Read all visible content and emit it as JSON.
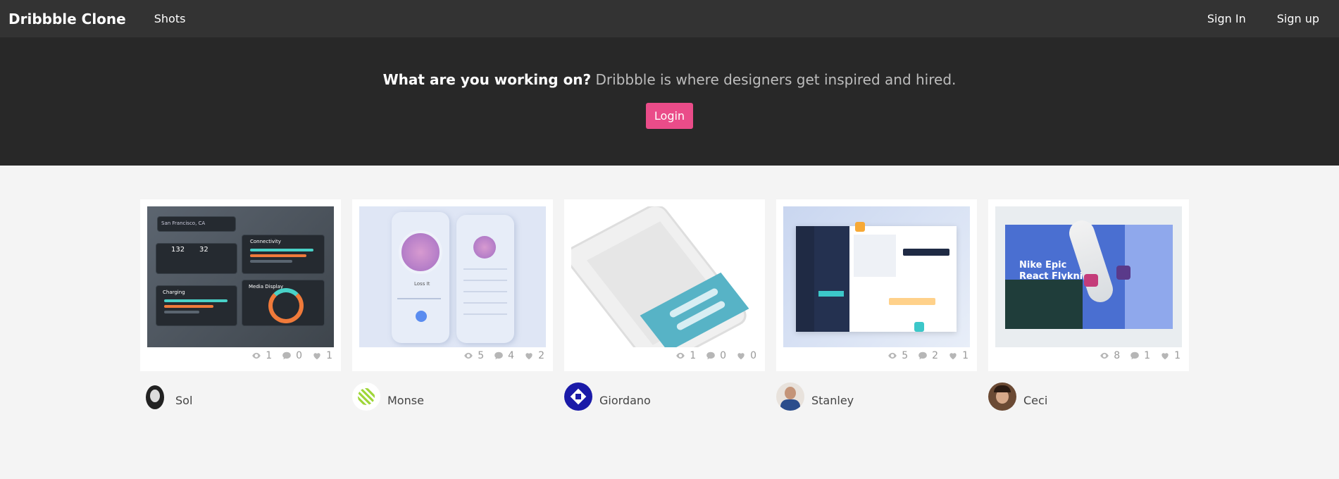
{
  "navbar": {
    "brand": "Dribbble Clone",
    "links": [
      "Shots"
    ],
    "right_links": [
      "Sign In",
      "Sign up"
    ]
  },
  "hero": {
    "headline_strong": "What are you working on?",
    "headline_rest": " Dribbble is where designers get inspired and hired.",
    "login_label": "Login"
  },
  "shots": [
    {
      "views": "1",
      "comments": "0",
      "likes": "1",
      "author": "Sol",
      "thumb_text": [
        "San Francisco, CA",
        "132",
        "32",
        "Connectivity",
        "Charging",
        "Media Display"
      ]
    },
    {
      "views": "5",
      "comments": "4",
      "likes": "2",
      "author": "Monse",
      "thumb_text": [
        "Loss It"
      ]
    },
    {
      "views": "1",
      "comments": "0",
      "likes": "0",
      "author": "Giordano",
      "thumb_text": []
    },
    {
      "views": "5",
      "comments": "2",
      "likes": "1",
      "author": "Stanley",
      "thumb_text": []
    },
    {
      "views": "8",
      "comments": "1",
      "likes": "1",
      "author": "Ceci",
      "thumb_text": [
        "Nike Epic",
        "React Flyknit"
      ]
    }
  ],
  "colors": {
    "navbar_bg": "#333333",
    "hero_bg": "#282828",
    "accent": "#ea4c89",
    "page_bg": "#f4f4f4"
  },
  "icons": {
    "views": "eye-icon",
    "comments": "comment-icon",
    "likes": "heart-icon"
  }
}
